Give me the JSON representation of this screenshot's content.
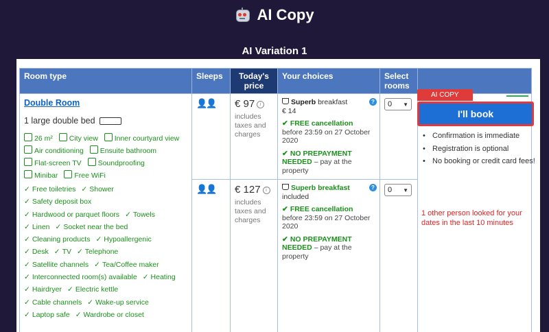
{
  "brand": "AI Copy",
  "variation": "AI Variation 1",
  "table": {
    "headers": {
      "room_type": "Room type",
      "sleeps": "Sleeps",
      "price": "Today's price",
      "choices": "Your choices",
      "select": "Select rooms"
    },
    "room": {
      "name": "Double Room",
      "bed": "1 large double bed",
      "facilities": [
        "26 m²",
        "City view",
        "Inner courtyard view",
        "Air conditioning",
        "Ensuite bathroom",
        "Flat-screen TV",
        "Soundproofing",
        "Minibar",
        "Free WiFi"
      ],
      "amenities": [
        "Free toiletries",
        "Shower",
        "Safety deposit box",
        "Hardwood or parquet floors",
        "Towels",
        "Linen",
        "Socket near the bed",
        "Cleaning products",
        "Hypoallergenic",
        "Desk",
        "TV",
        "Telephone",
        "Satellite channels",
        "Tea/Coffee maker",
        "Interconnected room(s) available",
        "Heating",
        "Hairdryer",
        "Electric kettle",
        "Cable channels",
        "Wake-up service",
        "Laptop safe",
        "Wardrobe or closet"
      ]
    },
    "options": [
      {
        "price": "€ 97",
        "price_note": "includes taxes and charges",
        "breakfast_bold": "Superb",
        "breakfast_rest": "breakfast",
        "breakfast_price": "€ 14",
        "cancel_title": "FREE cancellation",
        "cancel_detail": "before 23:59 on 27 October 2020",
        "prepay_title": "NO PREPAYMENT NEEDED",
        "prepay_detail": "– pay at the property",
        "qty": "0"
      },
      {
        "price": "€ 127",
        "price_note": "includes taxes and charges",
        "breakfast_bold": "Superb breakfast",
        "breakfast_rest": "included",
        "cancel_title": "FREE cancellation",
        "cancel_detail": "before 23:59 on 27 October 2020",
        "prepay_title": "NO PREPAYMENT NEEDED",
        "prepay_detail": "– pay at the property",
        "qty": "0"
      }
    ]
  },
  "booking": {
    "tag": "AI COPY",
    "button": "I'll book",
    "bullets": [
      "Confirmation is immediate",
      "Registration is optional",
      "No booking or credit card fees!"
    ],
    "looked": "1 other person looked for your dates in the last 10 minutes"
  },
  "colors": {
    "background": "#1f1838",
    "header_blue": "#4c76be",
    "price_header": "#1d3a72",
    "green": "#1b8f1b",
    "link": "#0b63c4",
    "accent_red": "#e03b3b",
    "button_blue": "#1d6fd6"
  }
}
